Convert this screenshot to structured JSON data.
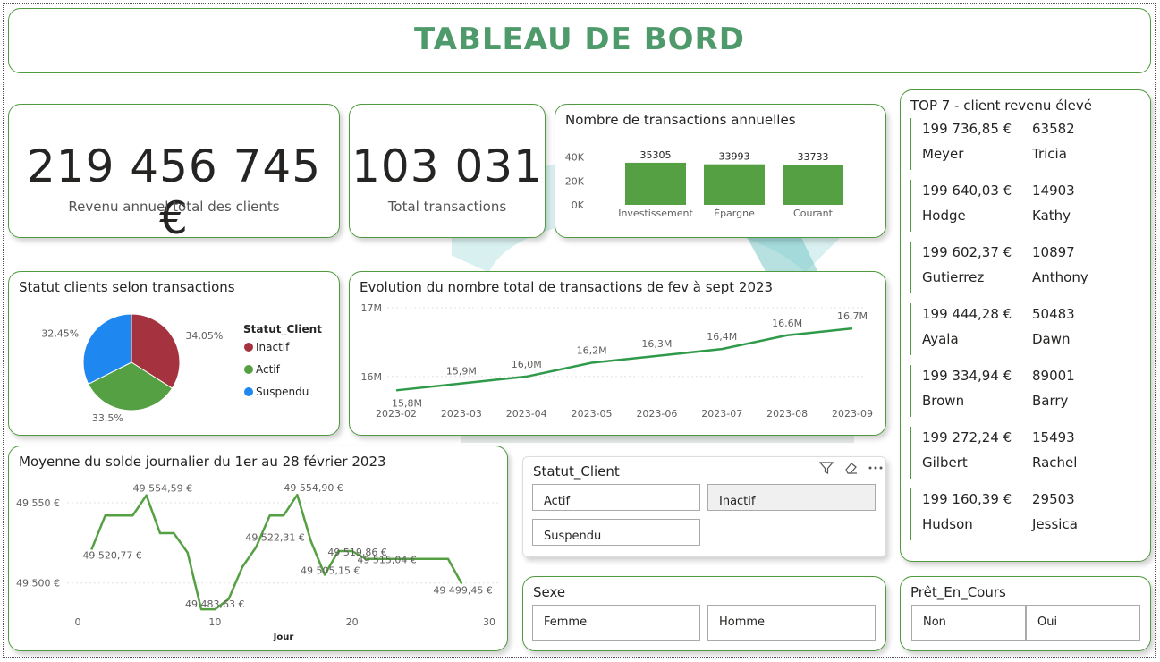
{
  "header": {
    "title": "TABLEAU DE BORD"
  },
  "kpis": {
    "revenue_value": "219 456 745 €",
    "revenue_label": "Revenu annuel total des clients",
    "transactions_value": "103 031",
    "transactions_label": "Total transactions"
  },
  "annual_chart": {
    "title": "Nombre de transactions annuelles",
    "chart_data": {
      "type": "bar",
      "categories": [
        "Investissement",
        "Épargne",
        "Courant"
      ],
      "values": [
        35305,
        33993,
        33733
      ],
      "data_labels": [
        "35305",
        "33993",
        "33733"
      ],
      "y_ticks": [
        "0K",
        "20K",
        "40K"
      ],
      "ylim": [
        0,
        45000
      ],
      "color": "#55a043"
    }
  },
  "status_chart": {
    "title": "Statut clients selon transactions",
    "legend_title": "Statut_Client",
    "chart_data": {
      "type": "pie",
      "labels": [
        "Inactif",
        "Actif",
        "Suspendu"
      ],
      "values": [
        34.05,
        33.5,
        32.45
      ],
      "data_labels": [
        "34,05%",
        "33,5%",
        "32,45%"
      ],
      "colors": [
        "#a5333f",
        "#55a043",
        "#1e88f0"
      ],
      "legend_placement": "right"
    }
  },
  "evolution_chart": {
    "title": "Evolution du nombre total de transactions de fev à sept 2023",
    "chart_data": {
      "type": "line",
      "x": [
        "2023-02",
        "2023-03",
        "2023-04",
        "2023-05",
        "2023-06",
        "2023-07",
        "2023-08",
        "2023-09"
      ],
      "values": [
        15.8,
        15.9,
        16.0,
        16.2,
        16.3,
        16.4,
        16.6,
        16.7
      ],
      "data_labels": [
        "15,8M",
        "15,9M",
        "16,0M",
        "16,2M",
        "16,3M",
        "16,4M",
        "16,6M",
        "16,7M"
      ],
      "y_ticks": [
        "16M",
        "17M"
      ],
      "ylim": [
        15.7,
        17.0
      ],
      "color": "#2f9a4a"
    }
  },
  "daily_chart": {
    "title": "Moyenne du solde journalier du 1er au 28 février 2023",
    "chart_data": {
      "type": "line",
      "xlabel": "Jour",
      "x_ticks": [
        "0",
        "10",
        "20",
        "30"
      ],
      "y_ticks": [
        "49 500 €",
        "49 550 €"
      ],
      "xlim": [
        0,
        30
      ],
      "ylim": [
        49482,
        49560
      ],
      "x": [
        1,
        2,
        3,
        4,
        5,
        6,
        7,
        8,
        9,
        10,
        11,
        12,
        13,
        14,
        15,
        16,
        17,
        18,
        19,
        20,
        21,
        22,
        23,
        24,
        25,
        26,
        27,
        28
      ],
      "values": [
        49520.77,
        49542,
        49542,
        49542,
        49554.59,
        49531,
        49531,
        49519,
        49483.63,
        49483.63,
        49490,
        49510,
        49522.31,
        49542,
        49542,
        49554.9,
        49526,
        49505.15,
        49519.86,
        49519.86,
        49515.04,
        49515.04,
        49515.04,
        49515.04,
        49515.04,
        49515.04,
        49515.04,
        49499.45
      ],
      "annotations": [
        {
          "x": 1,
          "y": 49520.77,
          "text": "49 520,77 €"
        },
        {
          "x": 5,
          "y": 49554.59,
          "text": "49 554,59 €"
        },
        {
          "x": 9,
          "y": 49483.63,
          "text": "49 483,63 €"
        },
        {
          "x": 13,
          "y": 49522.31,
          "text": "49 522,31 €"
        },
        {
          "x": 16,
          "y": 49554.9,
          "text": "49 554,90 €"
        },
        {
          "x": 18,
          "y": 49505.15,
          "text": "49 505,15 €"
        },
        {
          "x": 19,
          "y": 49519.86,
          "text": "49 519,86 €"
        },
        {
          "x": 22,
          "y": 49515.04,
          "text": "49 515,04 €"
        },
        {
          "x": 28,
          "y": 49499.45,
          "text": "49 499,45 €"
        }
      ],
      "color": "#55a043"
    }
  },
  "top_clients": {
    "title": "TOP 7 - client revenu élevé",
    "entries": [
      {
        "revenue": "199 736,85 €",
        "id": "63582",
        "last": "Meyer",
        "first": "Tricia"
      },
      {
        "revenue": "199 640,03 €",
        "id": "14903",
        "last": "Hodge",
        "first": "Kathy"
      },
      {
        "revenue": "199 602,37 €",
        "id": "10897",
        "last": "Gutierrez",
        "first": "Anthony"
      },
      {
        "revenue": "199 444,28 €",
        "id": "50483",
        "last": "Ayala",
        "first": "Dawn"
      },
      {
        "revenue": "199 334,94 €",
        "id": "89001",
        "last": "Brown",
        "first": "Barry"
      },
      {
        "revenue": "199 272,24 €",
        "id": "15493",
        "last": "Gilbert",
        "first": "Rachel"
      },
      {
        "revenue": "199 160,39 €",
        "id": "29503",
        "last": "Hudson",
        "first": "Jessica"
      }
    ]
  },
  "slicer_status": {
    "title": "Statut_Client",
    "options": [
      "Actif",
      "Inactif",
      "Suspendu"
    ],
    "selected": "Inactif",
    "icons": [
      "filter-icon",
      "eraser-icon",
      "more-options-icon"
    ]
  },
  "slicer_sex": {
    "title": "Sexe",
    "options": [
      "Femme",
      "Homme"
    ]
  },
  "slicer_loan": {
    "title": "Prêt_En_Cours",
    "options": [
      "Non",
      "Oui"
    ]
  }
}
